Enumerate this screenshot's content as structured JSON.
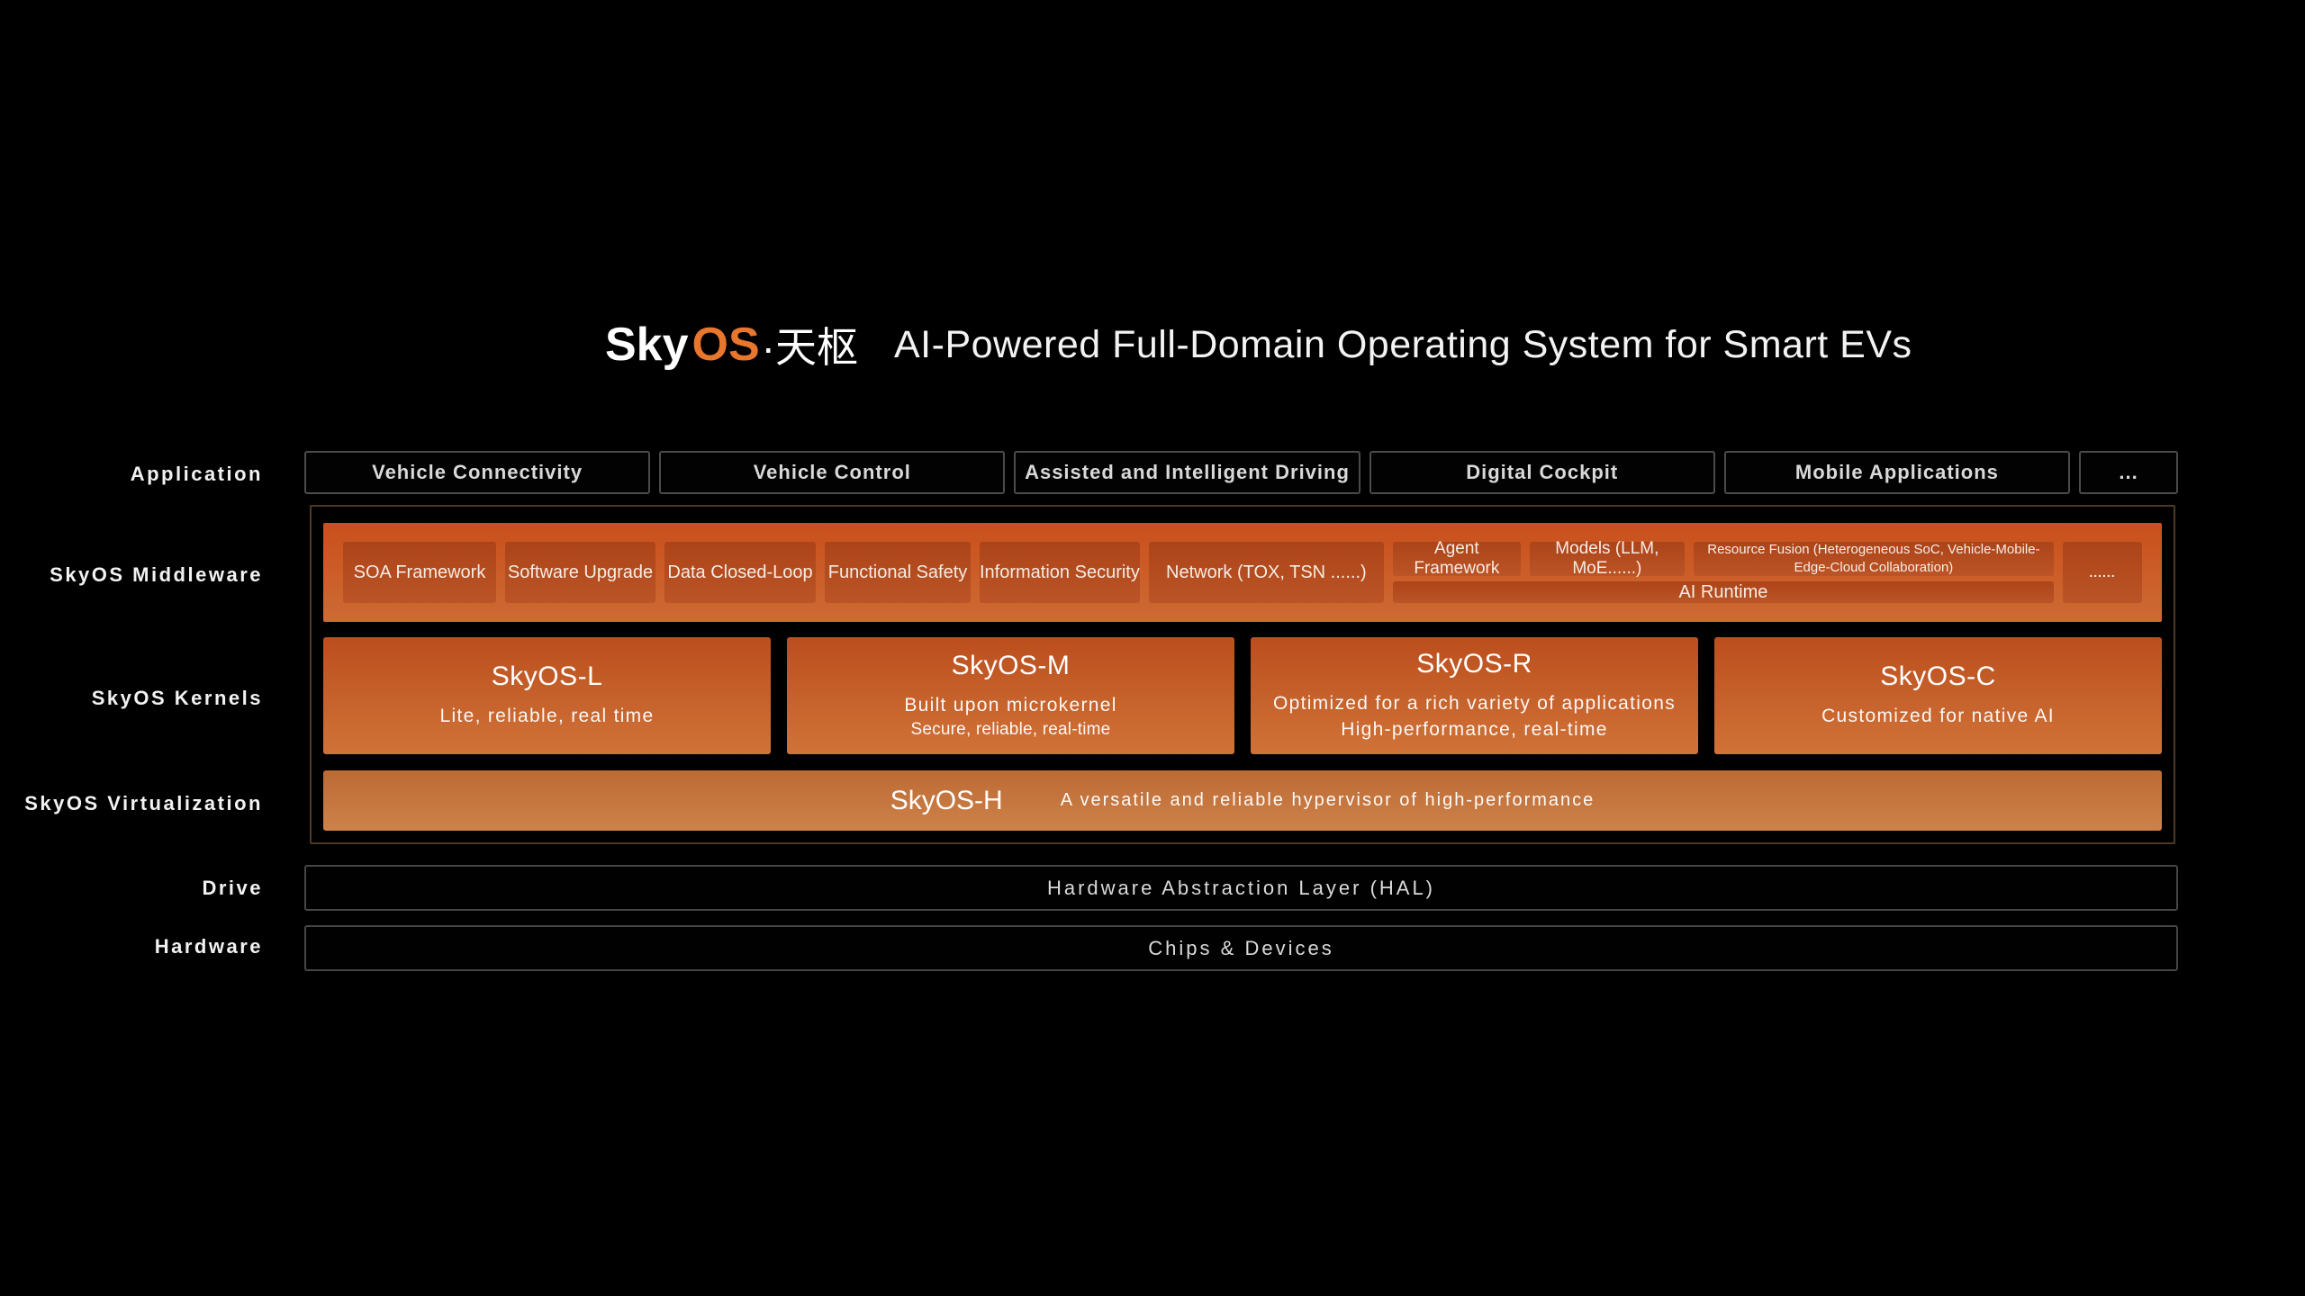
{
  "title": {
    "logo_sky": "Sky",
    "logo_os": "OS",
    "logo_suffix": "·天枢",
    "subtitle": "AI-Powered Full-Domain Operating System for Smart EVs"
  },
  "layers": {
    "application": {
      "label": "Application",
      "items": [
        "Vehicle Connectivity",
        "Vehicle Control",
        "Assisted and Intelligent Driving",
        "Digital Cockpit",
        "Mobile Applications",
        "..."
      ]
    },
    "middleware": {
      "label": "SkyOS Middleware",
      "items": [
        "SOA Framework",
        "Software Upgrade",
        "Data Closed-Loop",
        "Functional Safety",
        "Information Security",
        "Network (TOX, TSN ......)"
      ],
      "ai_cluster": {
        "agent": "Agent Framework",
        "models": "Models (LLM, MoE......)",
        "resource_fusion": "Resource Fusion (Heterogeneous SoC, Vehicle-Mobile-Edge-Cloud Collaboration)",
        "runtime": "AI Runtime",
        "more": "......"
      }
    },
    "kernels": {
      "label": "SkyOS Kernels",
      "items": [
        {
          "name": "SkyOS-L",
          "lines": [
            "Lite, reliable, real time"
          ]
        },
        {
          "name": "SkyOS-M",
          "lines": [
            "Built upon microkernel",
            "Secure, reliable, real-time"
          ]
        },
        {
          "name": "SkyOS-R",
          "lines": [
            "Optimized for a rich variety of applications",
            "High-performance, real-time"
          ]
        },
        {
          "name": "SkyOS-C",
          "lines": [
            "Customized for native AI"
          ]
        }
      ]
    },
    "virtualization": {
      "label": "SkyOS Virtualization",
      "name": "SkyOS-H",
      "description": "A versatile and reliable hypervisor of high-performance"
    },
    "drive": {
      "label": "Drive",
      "value": "Hardware Abstraction Layer (HAL)"
    },
    "hardware": {
      "label": "Hardware",
      "value": "Chips & Devices"
    }
  },
  "colors": {
    "background": "#000000",
    "accent_orange": "#E8762C",
    "middleware_gradient": [
      "#CA4F1C",
      "#CD6B34"
    ],
    "middleware_inner_gradient": [
      "#AC4419",
      "#BB5426"
    ],
    "kernel_gradient": [
      "#BB4E1D",
      "#D07338"
    ],
    "virtualization_gradient": [
      "#BD6A35",
      "#CD8249"
    ],
    "outline_gray": "#4B4B4B",
    "core_border_brown": "#4E3A24"
  }
}
